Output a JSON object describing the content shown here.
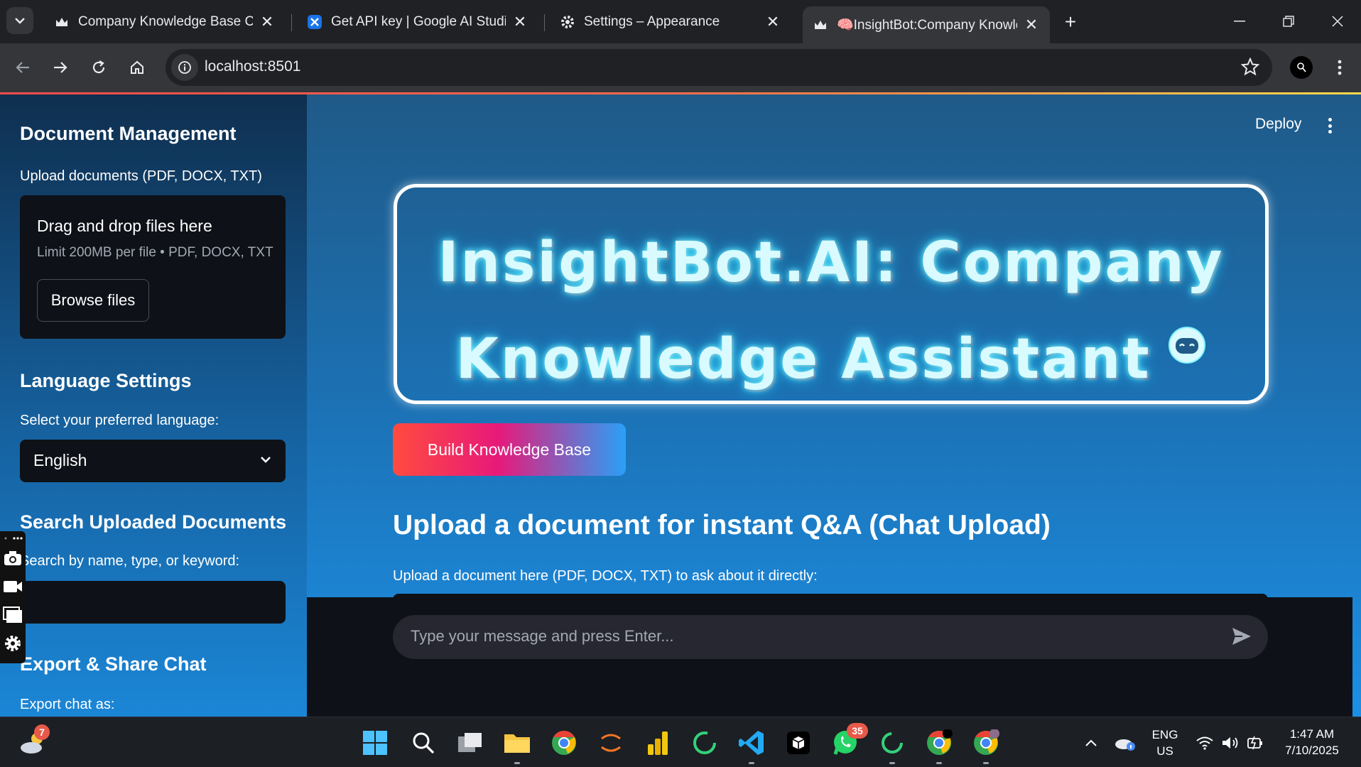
{
  "browser": {
    "tabs": [
      {
        "title": "Company Knowledge Base Chat",
        "active": false
      },
      {
        "title": "Get API key | Google AI Studio",
        "active": false
      },
      {
        "title": "Settings – Appearance",
        "active": false
      },
      {
        "title": "🧠InsightBot:Company Knowledge",
        "active": true
      }
    ],
    "url": "localhost:8501"
  },
  "sidebar": {
    "doc_mgmt_heading": "Document Management",
    "upload_label": "Upload documents (PDF, DOCX, TXT)",
    "dropzone_title": "Drag and drop files here",
    "dropzone_limit": "Limit 200MB per file • PDF, DOCX, TXT",
    "browse_label": "Browse files",
    "lang_heading": "Language Settings",
    "lang_label": "Select your preferred language:",
    "lang_value": "English",
    "search_heading": "Search Uploaded Documents",
    "search_label": "Search by name, type, or keyword:",
    "search_value": "",
    "export_heading": "Export & Share Chat",
    "export_label": "Export chat as:"
  },
  "main": {
    "deploy_label": "Deploy",
    "hero_title_line1": "InsightBot.AI: Company",
    "hero_title_line2": "Knowledge Assistant",
    "build_label": "Build Knowledge Base",
    "chat_upload_heading": "Upload a document for instant Q&A (Chat Upload)",
    "chat_upload_label": "Upload a document here (PDF, DOCX, TXT) to ask about it directly:",
    "chat_placeholder": "Type your message and press Enter..."
  },
  "taskbar": {
    "weather_badge": "7",
    "whatsapp_badge": "35",
    "lang_line1": "ENG",
    "lang_line2": "US",
    "time": "1:47 AM",
    "date": "7/10/2025"
  },
  "colors": {
    "accent_gradient": [
      "#ff4b3e",
      "#e8197a",
      "#2aa0f7"
    ],
    "app_dark": "#0e1117"
  }
}
